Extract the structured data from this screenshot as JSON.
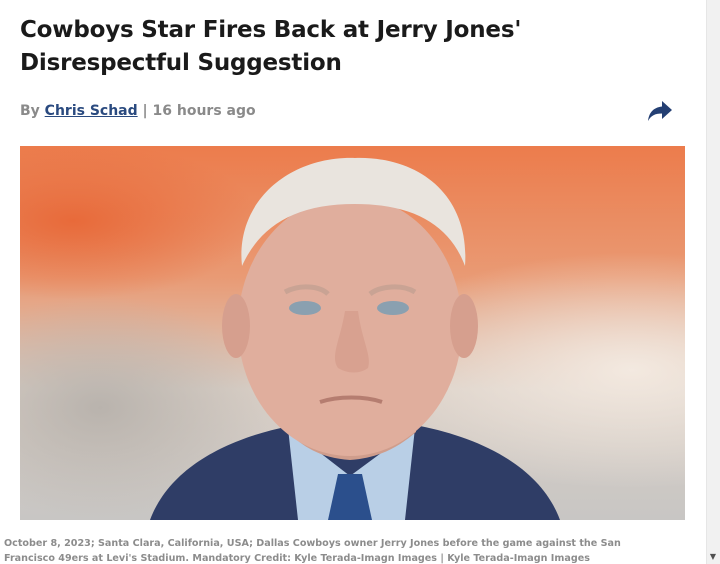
{
  "article": {
    "headline": "Cowboys Star Fires Back at Jerry Jones' Disrespectful Suggestion",
    "byline_prefix": "By",
    "author": "Chris Schad",
    "byline_separator": "|",
    "timestamp": "16 hours ago",
    "share_icon": "share-arrow-icon",
    "image_caption": "October 8, 2023; Santa Clara, California, USA; Dallas Cowboys owner Jerry Jones before the game against the San Francisco 49ers at Levi's Stadium. Mandatory Credit: Kyle Terada-Imagn Images | Kyle Terada-Imagn Images"
  },
  "colors": {
    "headline": "#1a1a1a",
    "author_link": "#2a4a7f",
    "byline_text": "#8a8a8a",
    "share_icon": "#243f73"
  },
  "scrollbar": {
    "down_arrow_icon": "chevron-down-icon"
  }
}
